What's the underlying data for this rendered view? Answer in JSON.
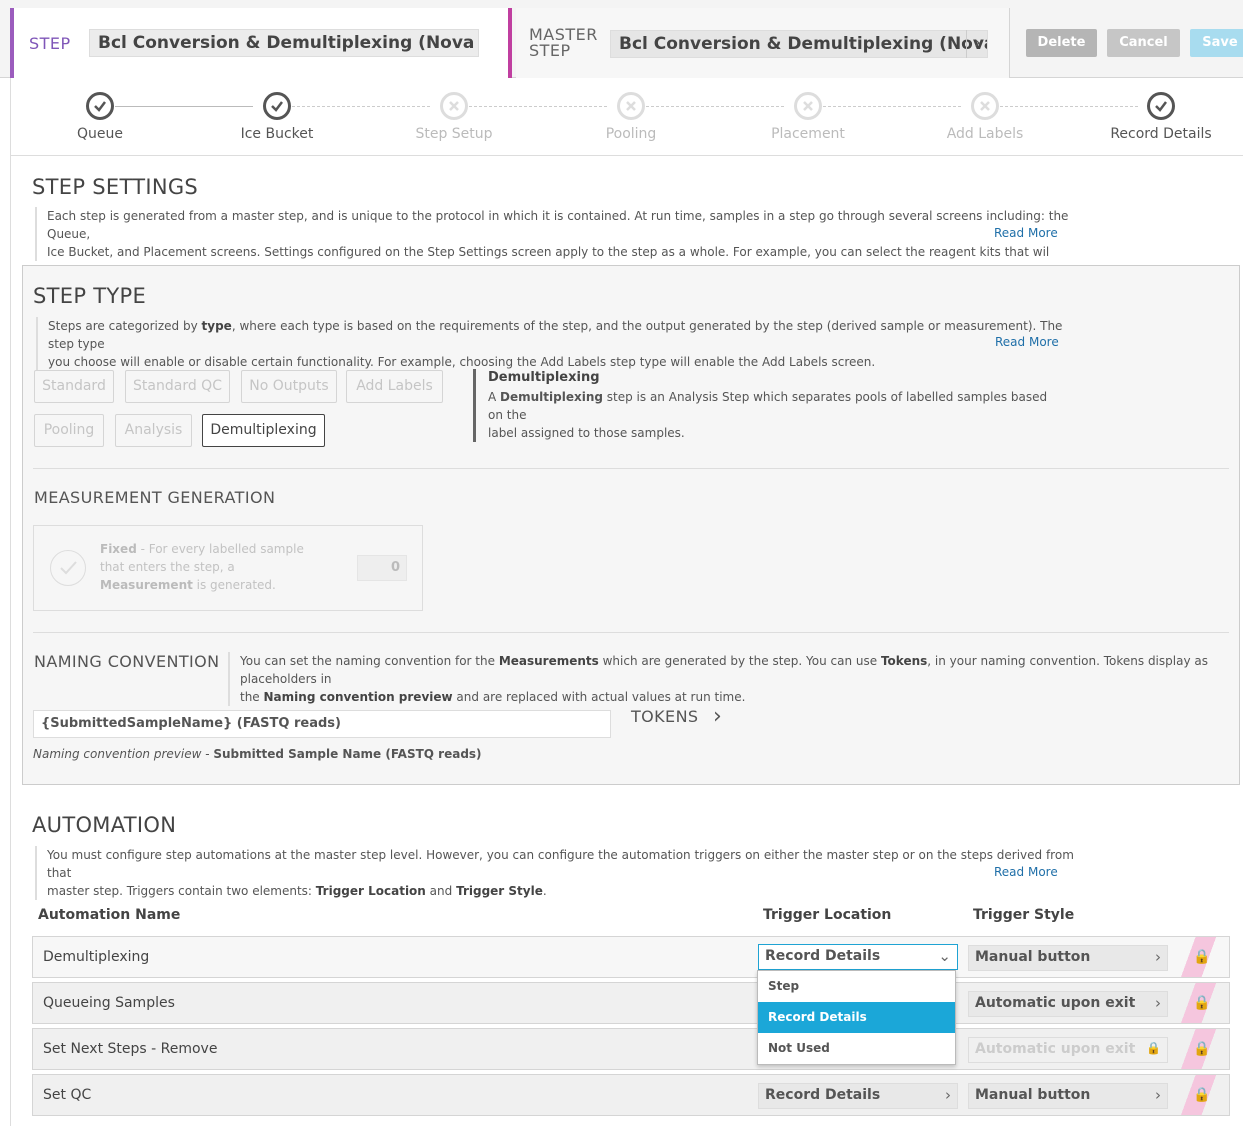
{
  "header": {
    "step_label": "STEP",
    "step_name": "Bcl Conversion & Demultiplexing (Nova Seq)",
    "master_label": "MASTER STEP",
    "master_name": "Bcl Conversion & Demultiplexing (Nova ...",
    "delete": "Delete",
    "cancel": "Cancel",
    "save": "Save"
  },
  "progress": [
    {
      "label": "Queue",
      "state": "done"
    },
    {
      "label": "Ice Bucket",
      "state": "done"
    },
    {
      "label": "Step Setup",
      "state": "disabled"
    },
    {
      "label": "Pooling",
      "state": "disabled"
    },
    {
      "label": "Placement",
      "state": "disabled"
    },
    {
      "label": "Add Labels",
      "state": "disabled"
    },
    {
      "label": "Record Details",
      "state": "done"
    }
  ],
  "step_settings": {
    "title": "STEP SETTINGS",
    "desc1": "Each step is generated from a master step, and is unique to the protocol in which it is contained. At run time, samples in a step go through several screens including: the Queue,",
    "desc2": "Ice Bucket, and Placement screens. Settings configured on the Step Settings screen apply to the step as a whole. For example, you can select the reagent kits that wil",
    "read_more": "Read More"
  },
  "step_type": {
    "title": "STEP TYPE",
    "desc1_a": "Steps are categorized by ",
    "desc1_b": "type",
    "desc1_c": ", where each type is based on the requirements of the step, and the output generated by the step (derived sample or measurement). The step type",
    "desc2": "you choose will enable or disable certain functionality. For example, choosing the Add Labels step type will enable the Add Labels screen.",
    "read_more": "Read More",
    "types": [
      "Standard",
      "Standard QC",
      "No Outputs",
      "Add Labels",
      "Pooling",
      "Analysis",
      "Demultiplexing"
    ],
    "selected": "Demultiplexing",
    "info_title": "Demultiplexing",
    "info_a": "A ",
    "info_b": "Demultiplexing",
    "info_c": " step is an Analysis Step which separates pools of labelled samples based on the",
    "info_d": "label assigned to those samples."
  },
  "measurement": {
    "title": "MEASUREMENT GENERATION",
    "fixed": "Fixed",
    "text_a": " - For every labelled sample that enters the step, a ",
    "text_b": "Measurement",
    "text_c": " is generated.",
    "count": "0"
  },
  "naming": {
    "title": "NAMING CONVENTION",
    "desc_a": "You can set the naming convention for the ",
    "desc_b": "Measurements",
    "desc_c": " which are generated by the step. You can use ",
    "desc_d": "Tokens",
    "desc_e": ", in your naming convention. Tokens display as placeholders in",
    "desc_f": "the ",
    "desc_g": "Naming convention preview",
    "desc_h": " and are replaced with actual values at run time.",
    "value": "{SubmittedSampleName} (FASTQ reads)",
    "tokens": "TOKENS",
    "preview_label": "Naming convention preview",
    "preview_value": "Submitted Sample Name (FASTQ reads)"
  },
  "automation": {
    "title": "AUTOMATION",
    "desc1": "You must configure step automations at the master step level. However, you can configure the automation triggers on either the master step or on the steps derived from that",
    "desc2_a": "master step. Triggers contain two elements: ",
    "desc2_b": "Trigger Location",
    "desc2_c": " and ",
    "desc2_d": "Trigger Style",
    "desc2_e": ".",
    "read_more": "Read More",
    "col_name": "Automation Name",
    "col_location": "Trigger Location",
    "col_style": "Trigger Style",
    "rows": [
      {
        "name": "Demultiplexing",
        "location": "Record Details",
        "style": "Manual button"
      },
      {
        "name": "Queueing Samples",
        "location": "",
        "style": "Automatic upon exit"
      },
      {
        "name": "Set Next Steps - Remove",
        "location": "",
        "style": "Automatic upon exit"
      },
      {
        "name": "Set QC",
        "location": "Record Details",
        "style": "Manual button"
      }
    ],
    "dropdown_options": [
      "Step",
      "Record Details",
      "Not Used"
    ],
    "dropdown_selected": "Record Details"
  }
}
